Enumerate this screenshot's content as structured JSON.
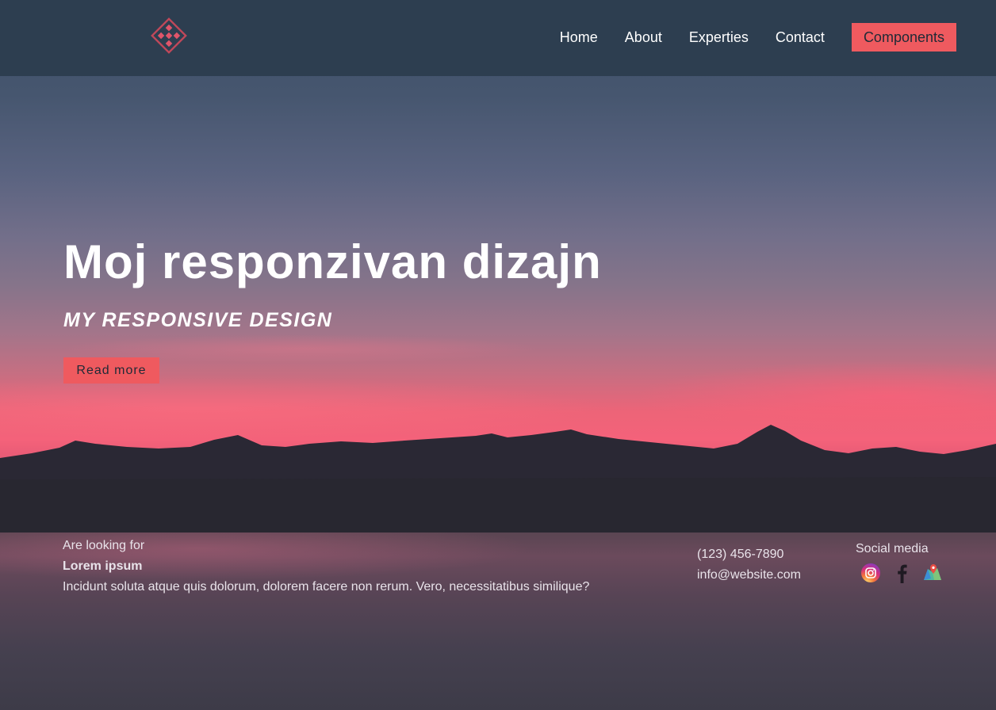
{
  "nav": {
    "logo": "logo",
    "links": [
      "Home",
      "About",
      "Experties",
      "Contact"
    ],
    "cta_label": "Components"
  },
  "hero": {
    "title": "Moj responzivan dizajn",
    "subtitle": "MY RESPONSIVE DESIGN",
    "button_label": "Read more"
  },
  "footer": {
    "intro": "Are looking for",
    "heading": "Lorem ipsum",
    "text": "Incidunt soluta atque quis dolorum, dolorem facere non rerum. Vero, necessitatibus similique?",
    "phone": "(123) 456-7890",
    "email": "info@website.com",
    "social_title": "Social media",
    "social_icons": [
      "instagram-icon",
      "facebook-icon",
      "maps-icon"
    ]
  },
  "colors": {
    "navbar": "#2d3e50",
    "accent": "#ef5a5f",
    "text_light": "#ffffff"
  }
}
